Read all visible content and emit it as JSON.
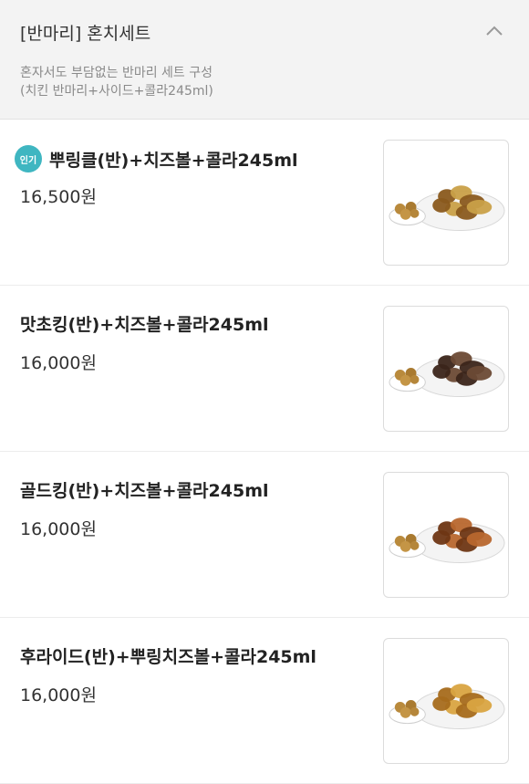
{
  "section": {
    "title": "[반마리] 혼치세트",
    "desc_line1": "혼자서도 부담없는 반마리 세트 구성",
    "desc_line2": "(치킨 반마리+사이드+콜라245ml)"
  },
  "items": [
    {
      "badge": "인기",
      "name": "뿌링클(반)+치즈볼+콜라245ml",
      "price": "16,500원",
      "image": "fried-chicken-plate-icon",
      "colors": {
        "chicken": "#c9a048",
        "dark": "#8a5a1e"
      }
    },
    {
      "badge": "",
      "name": "맛초킹(반)+치즈볼+콜라245ml",
      "price": "16,000원",
      "image": "fried-chicken-plate-icon",
      "colors": {
        "chicken": "#6b4a35",
        "dark": "#3b251a"
      }
    },
    {
      "badge": "",
      "name": "골드킹(반)+치즈볼+콜라245ml",
      "price": "16,000원",
      "image": "fried-chicken-plate-icon",
      "colors": {
        "chicken": "#b8672e",
        "dark": "#6e3614"
      }
    },
    {
      "badge": "",
      "name": "후라이드(반)+뿌링치즈볼+콜라245ml",
      "price": "16,000원",
      "image": "fried-chicken-plate-icon",
      "colors": {
        "chicken": "#d9a441",
        "dark": "#a66c1c"
      }
    }
  ],
  "accent": "#3fb6c1"
}
